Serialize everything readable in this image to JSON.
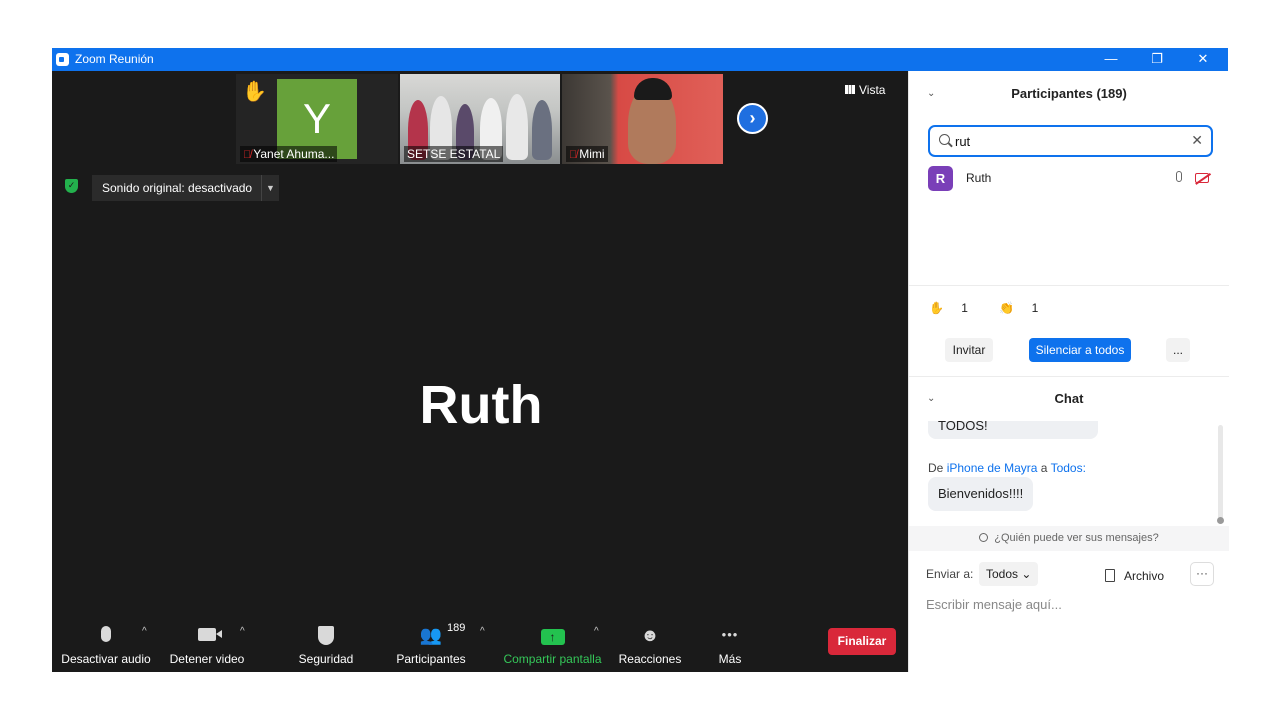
{
  "window": {
    "title": "Zoom Reunión",
    "minimize_icon": "—",
    "restore_icon": "❐",
    "close_icon": "✕"
  },
  "video": {
    "view_label": "Vista",
    "thumbnails": [
      {
        "name": "Yanet Ahuma...",
        "avatar_letter": "Y",
        "hand_raised": true,
        "muted": true
      },
      {
        "name": "SETSE ESTATAL",
        "muted": false
      },
      {
        "name": "Mimi",
        "muted": true
      }
    ],
    "next_icon": "›",
    "original_sound": "Sonido original: desactivado",
    "active_speaker": "Ruth"
  },
  "toolbar": {
    "audio": "Desactivar audio",
    "video": "Detener video",
    "security": "Seguridad",
    "participants": "Participantes",
    "participants_count": "189",
    "share": "Compartir pantalla",
    "reactions": "Reacciones",
    "more": "Más",
    "end": "Finalizar",
    "caret": "^",
    "more_icon": "•••"
  },
  "participants_panel": {
    "title": "Participantes (189)",
    "search_value": "rut",
    "results": [
      {
        "initial": "R",
        "name": "Ruth"
      }
    ],
    "reactions": [
      {
        "emoji": "✋",
        "count": "1"
      },
      {
        "emoji": "👏",
        "count": "1"
      }
    ],
    "invite": "Invitar",
    "mute_all": "Silenciar a todos",
    "more": "..."
  },
  "chat": {
    "title": "Chat",
    "prev_message": "TODOS!",
    "from_prefix": "De",
    "from_sender": "iPhone de Mayra",
    "from_mid": "a",
    "from_to": "Todos:",
    "message": "Bienvenidos!!!!",
    "who_can_see": "¿Quién puede ver sus mensajes?",
    "send_to_label": "Enviar a:",
    "send_to_value": "Todos",
    "file": "Archivo",
    "more": "···",
    "input_placeholder": "Escribir mensaje aquí..."
  },
  "colors": {
    "titlebar": "#0e72ed",
    "video_bg": "#1a1a1a",
    "end_button": "#d9283a",
    "share_green": "#23c24f",
    "accent_blue": "#0e72ed"
  }
}
